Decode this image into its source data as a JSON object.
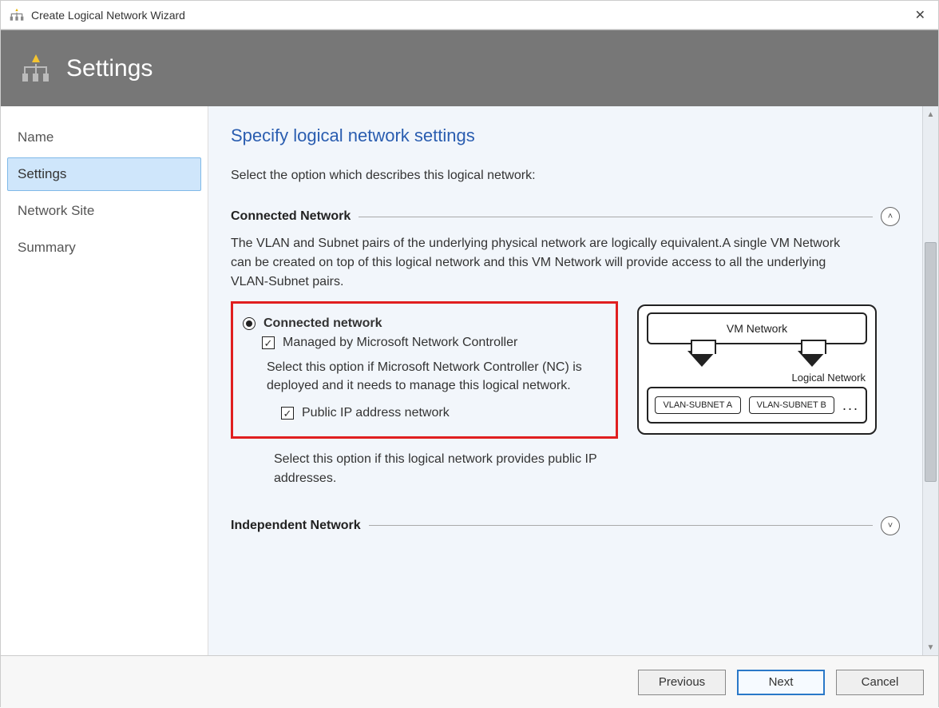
{
  "window": {
    "title": "Create Logical Network Wizard"
  },
  "banner": {
    "title": "Settings"
  },
  "sidebar": {
    "items": [
      {
        "label": "Name",
        "selected": false
      },
      {
        "label": "Settings",
        "selected": true
      },
      {
        "label": "Network Site",
        "selected": false
      },
      {
        "label": "Summary",
        "selected": false
      }
    ]
  },
  "content": {
    "heading": "Specify logical network settings",
    "instruction": "Select the option which describes this logical network:",
    "connected": {
      "section_title": "Connected Network",
      "description": "The VLAN and Subnet pairs of the underlying physical network are logically equivalent.A single VM Network can be created on top of this logical network and this VM Network will provide access to all the underlying VLAN-Subnet pairs.",
      "radio_label": "Connected network",
      "managed_label": "Managed by Microsoft Network Controller",
      "managed_desc": "Select this option if Microsoft Network Controller (NC) is deployed and it needs to manage this logical network.",
      "public_ip_label": "Public IP address network",
      "public_ip_desc": "Select this option if this logical network provides public IP addresses."
    },
    "independent": {
      "section_title": "Independent Network"
    },
    "diagram": {
      "vm": "VM Network",
      "ln": "Logical  Network",
      "sub_a": "VLAN-SUBNET A",
      "sub_b": "VLAN-SUBNET B",
      "dots": "..."
    }
  },
  "footer": {
    "previous": "Previous",
    "next": "Next",
    "cancel": "Cancel"
  },
  "glyphs": {
    "check": "✓",
    "chev_up": "˄",
    "chev_down": "˅",
    "tri_up": "▲",
    "tri_down": "▼",
    "close": "✕"
  }
}
